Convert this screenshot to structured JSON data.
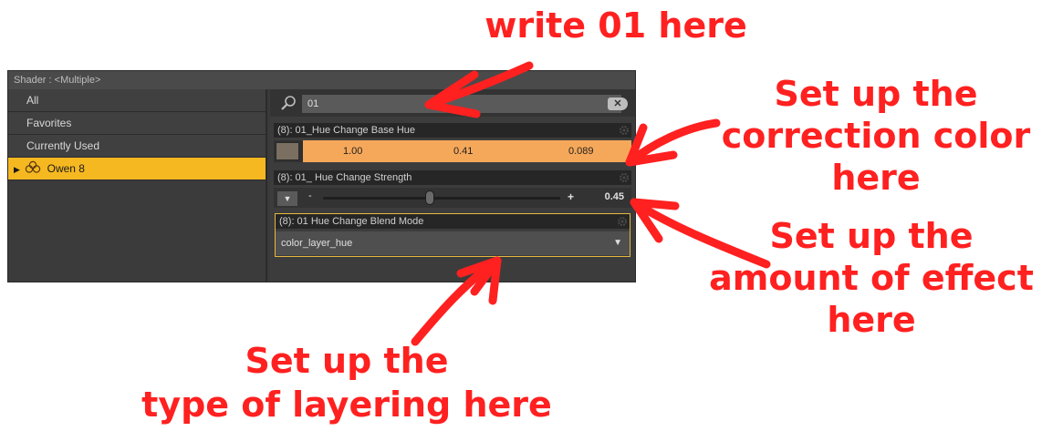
{
  "panel": {
    "title": "Shader : <Multiple>",
    "left_items": [
      {
        "label": "All"
      },
      {
        "label": "Favorites"
      },
      {
        "label": "Currently Used"
      },
      {
        "label": "Owen 8",
        "selected": true
      }
    ],
    "search": {
      "value": "01"
    },
    "props": {
      "base_hue": {
        "header": "(8): 01_Hue Change Base Hue",
        "values": [
          "1.00",
          "0.41",
          "0.089"
        ],
        "color": "#f6a85a"
      },
      "strength": {
        "header": "(8): 01_ Hue Change Strength",
        "minus": "-",
        "plus": "+",
        "value": "0.45",
        "fraction": 0.45
      },
      "blend_mode": {
        "header": "(8): 01 Hue Change Blend Mode",
        "value": "color_layer_hue"
      }
    }
  },
  "annotations": {
    "a1": "write 01 here",
    "a2_lines": [
      "Set up the",
      "correction color",
      "here"
    ],
    "a3_lines": [
      "Set up the",
      "amount of effect",
      "here"
    ],
    "a4_lines": [
      "Set up the",
      "type of layering here"
    ]
  },
  "colors": {
    "accent": "#f6b821",
    "annotation": "#ff2020",
    "panel": "#3a3a3a"
  }
}
